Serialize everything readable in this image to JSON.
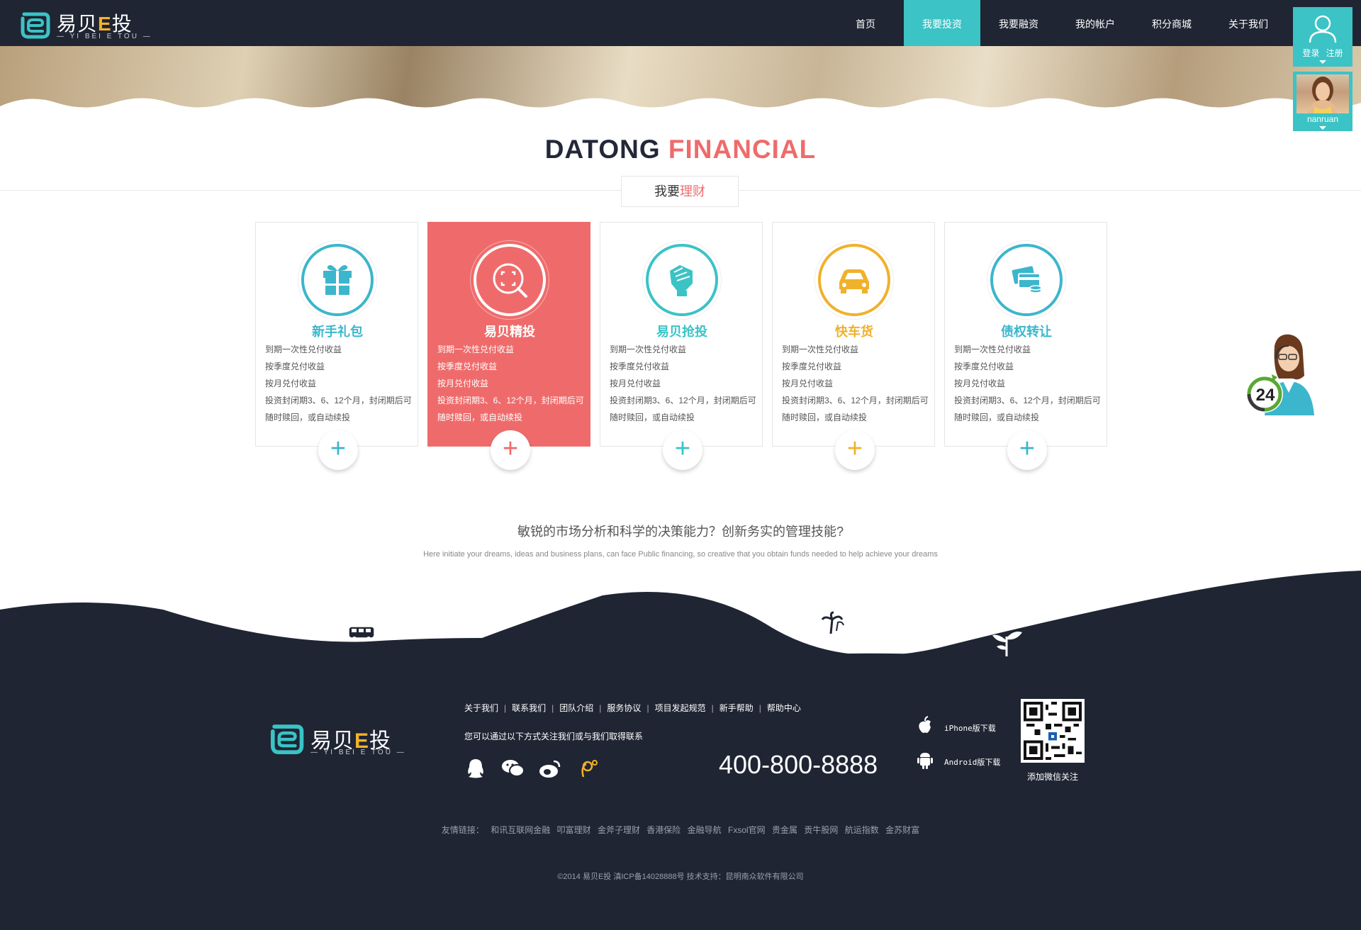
{
  "brand": {
    "name_cn_a": "易贝",
    "name_cn_e": "E",
    "name_cn_b": "投",
    "name_en": "— YI BEI E TOU —"
  },
  "nav": {
    "items": [
      {
        "label": "首页",
        "active": false
      },
      {
        "label": "我要投资",
        "active": true
      },
      {
        "label": "我要融资",
        "active": false
      },
      {
        "label": "我的帐户",
        "active": false
      },
      {
        "label": "积分商城",
        "active": false
      },
      {
        "label": "关于我们",
        "active": false
      }
    ]
  },
  "user_panel": {
    "login": "登录",
    "register": "注册",
    "username": "nanruan"
  },
  "title": {
    "part1": "DATONG ",
    "part2": "FINANCIAL"
  },
  "subtitle": {
    "part1": "我要",
    "part2": "理财"
  },
  "colors": {
    "teal": "#3bc3c6",
    "red": "#ef6b6b",
    "navy": "#1f2533",
    "blue": "#3cb6cc",
    "orange": "#f0b12b"
  },
  "cards": [
    {
      "title": "新手礼包",
      "icon": "gift-icon",
      "color": "#3cb6cc",
      "active": false,
      "lines": [
        "到期一次性兑付收益",
        "按季度兑付收益",
        "按月兑付收益",
        "投资封闭期3、6、12个月，封闭期后可",
        "随时赎回，或自动续投"
      ]
    },
    {
      "title": "易贝精投",
      "icon": "search-target-icon",
      "color": "#ef6b6b",
      "active": true,
      "lines": [
        "到期一次性兑付收益",
        "按季度兑付收益",
        "按月兑付收益",
        "投资封闭期3、6、12个月，封闭期后可",
        "随时赎回，或自动续投"
      ]
    },
    {
      "title": "易贝抢投",
      "icon": "fist-icon",
      "color": "#3bc3c6",
      "active": false,
      "lines": [
        "到期一次性兑付收益",
        "按季度兑付收益",
        "按月兑付收益",
        "投资封闭期3、6、12个月，封闭期后可",
        "随时赎回，或自动续投"
      ]
    },
    {
      "title": "快车货",
      "icon": "car-icon",
      "color": "#f0b12b",
      "active": false,
      "lines": [
        "到期一次性兑付收益",
        "按季度兑付收益",
        "按月兑付收益",
        "投资封闭期3、6、12个月，封闭期后可",
        "随时赎回，或自动续投"
      ]
    },
    {
      "title": "债权转让",
      "icon": "cards-icon",
      "color": "#3cb6cc",
      "active": false,
      "lines": [
        "到期一次性兑付收益",
        "按季度兑付收益",
        "按月兑付收益",
        "投资封闭期3、6、12个月，封闭期后可",
        "随时赎回，或自动续投"
      ]
    }
  ],
  "plus_symbol": "+",
  "support": {
    "hours": "24"
  },
  "slogan": {
    "cn": "敏锐的市场分析和科学的决策能力？创新务实的管理技能?",
    "en": "Here initiate your dreams, ideas and business plans, can face   Public financing, so creative that you obtain funds needed to help achieve your dreams"
  },
  "footer": {
    "links": [
      "关于我们",
      "联系我们",
      "团队介绍",
      "服务协议",
      "项目发起规范",
      "新手帮助",
      "帮助中心"
    ],
    "separator": "|",
    "follow_text": "您可以通过以下方式关注我们或与我们取得联系",
    "social": [
      "qq-icon",
      "wechat-icon",
      "weibo-icon",
      "tencent-weibo-icon"
    ],
    "phone": "400-800-8888",
    "iphone_label": "iPhone版下载",
    "android_label": "Android版下载",
    "qr_caption": "添加微信关注",
    "friends_label": "友情链接：",
    "friends": [
      "和讯互联网金融",
      "叩富理财",
      "金斧子理财",
      "香港保险",
      "金融导航",
      "Fxsol官网",
      "贵金属",
      "贡牛股网",
      "航运指数",
      "金苏财富"
    ],
    "copyright": "©2014 易贝E投 滇ICP备14028888号     技术支持：昆明南众软件有限公司"
  }
}
